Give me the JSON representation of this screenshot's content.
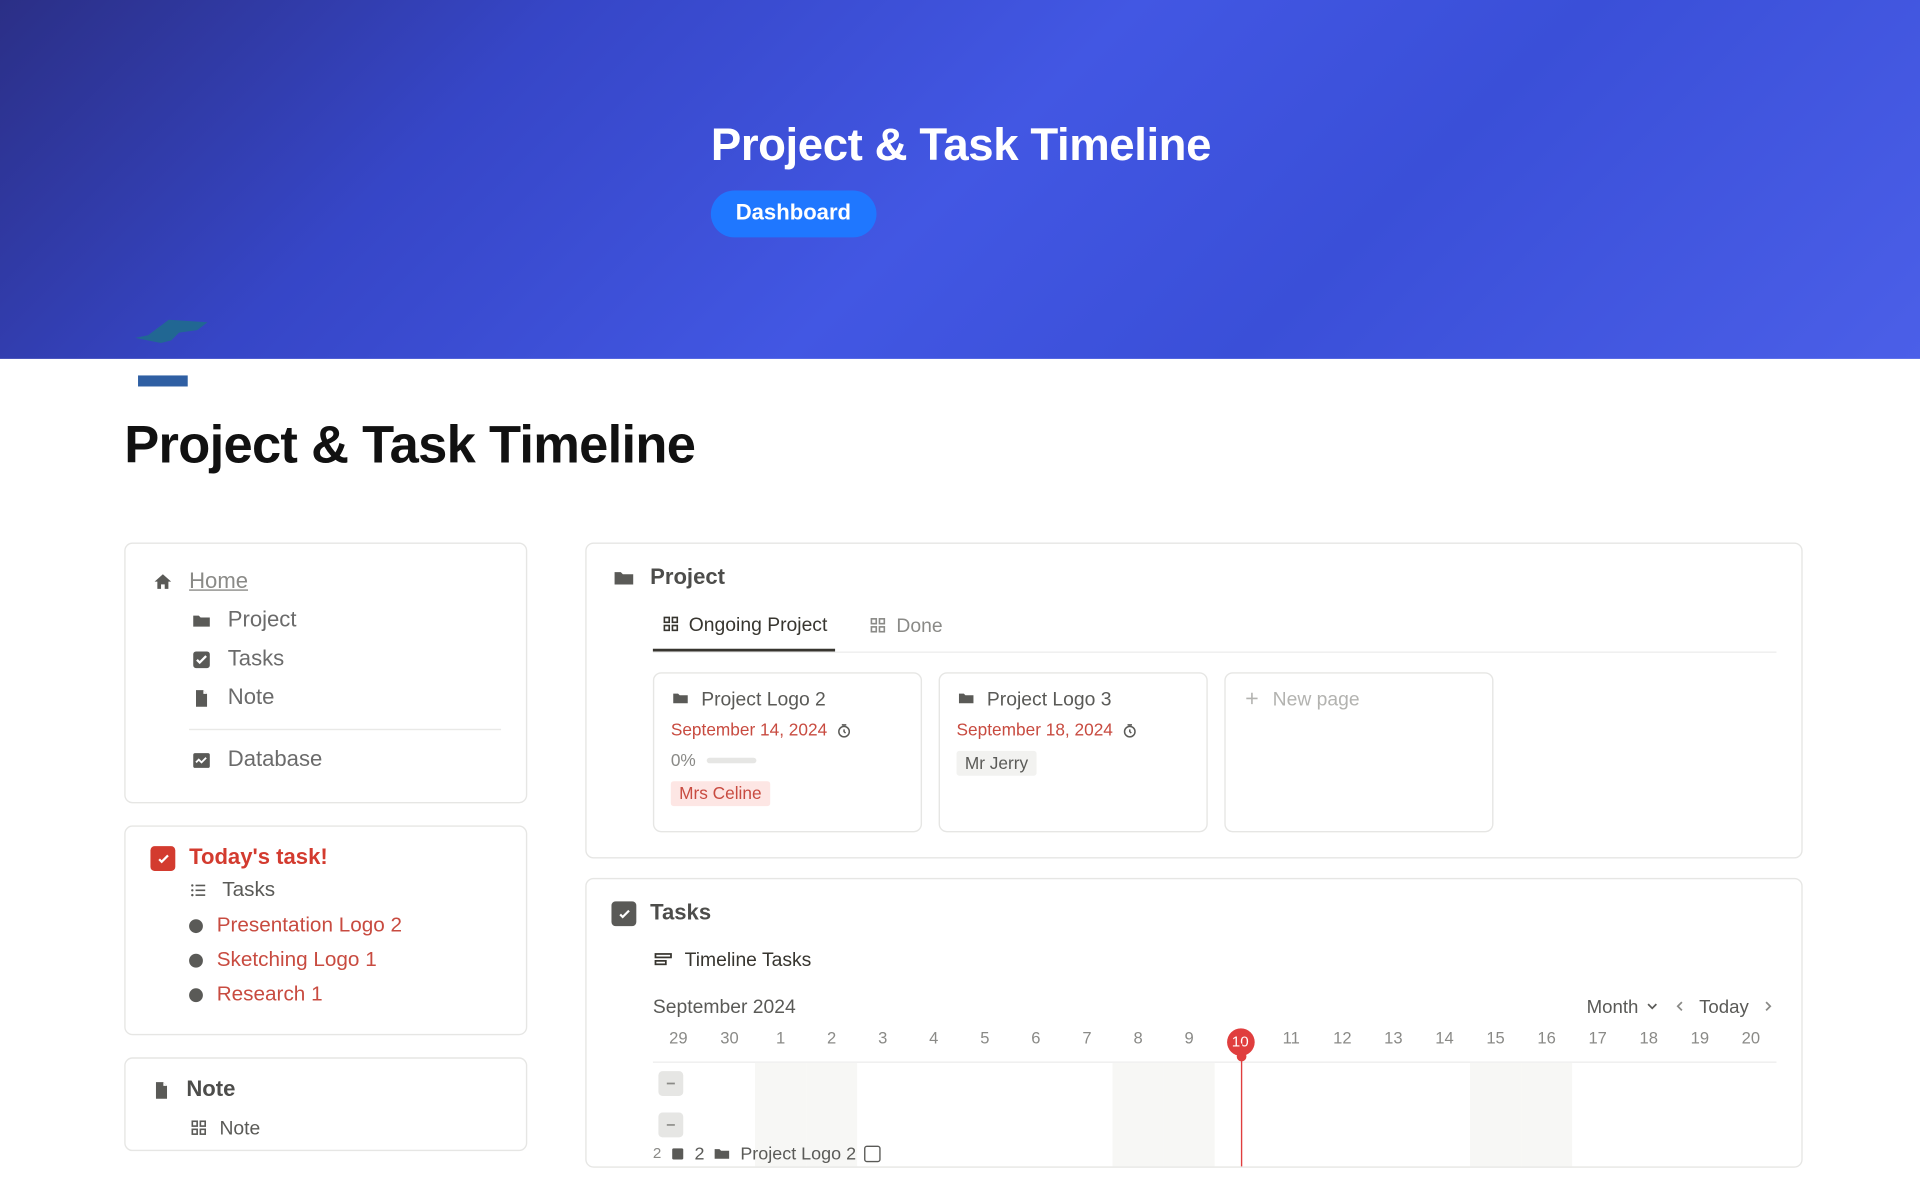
{
  "hero": {
    "title": "Project & Task Timeline",
    "badge": "Dashboard"
  },
  "page_title": "Project & Task Timeline",
  "sidebar": {
    "nav": {
      "home": "Home",
      "project": "Project",
      "tasks": "Tasks",
      "note": "Note",
      "database": "Database"
    },
    "today": {
      "heading": "Today's task!",
      "tasks_label": "Tasks",
      "items": [
        "Presentation Logo 2",
        "Sketching Logo 1",
        "Research 1"
      ]
    },
    "note": {
      "heading": "Note",
      "row": "Note"
    }
  },
  "project_panel": {
    "heading": "Project",
    "tabs": {
      "ongoing": "Ongoing Project",
      "done": "Done"
    },
    "cards": [
      {
        "title": "Project Logo 2",
        "date": "September 14, 2024",
        "progress": "0%",
        "person": "Mrs Celine"
      },
      {
        "title": "Project Logo 3",
        "date": "September 18, 2024",
        "person": "Mr Jerry"
      },
      {
        "title": "New page"
      }
    ]
  },
  "tasks_panel": {
    "heading": "Tasks",
    "view": "Timeline Tasks",
    "month_label": "September 2024",
    "scale": "Month",
    "today_btn": "Today",
    "days": [
      "29",
      "30",
      "1",
      "2",
      "3",
      "4",
      "5",
      "6",
      "7",
      "8",
      "9",
      "10",
      "11",
      "12",
      "13",
      "14",
      "15",
      "16",
      "17",
      "18",
      "19",
      "20"
    ],
    "current_day": "10",
    "row_count_hint": "2",
    "row_task": "Project Logo 2"
  }
}
